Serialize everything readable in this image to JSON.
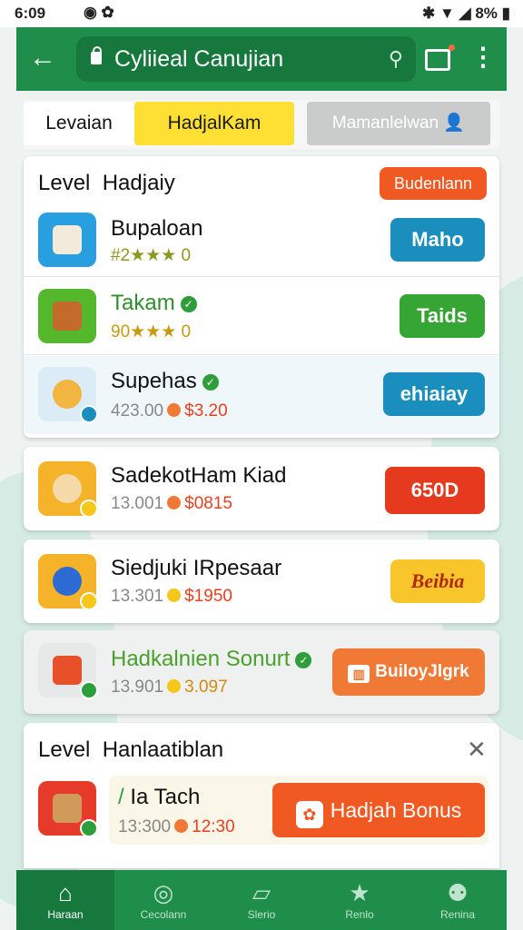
{
  "status_bar": {
    "time": "6:09",
    "battery": "8%"
  },
  "app_bar": {
    "title": "Cyliieal Canujian"
  },
  "tabs": [
    "Levaian",
    "HadjalKam",
    "Mamanlelwan"
  ],
  "section1": {
    "heading": "Level  Hadjaiy",
    "badge": "Budenlann",
    "items": [
      {
        "name": "Bupaloan",
        "sub": "#2★★★ 0",
        "button": "Maho",
        "button_color": "#1a8fbe"
      },
      {
        "name": "Takam",
        "sub": "90★★★ 0",
        "button": "Taids",
        "button_color": "#35a534"
      },
      {
        "name": "Supehas",
        "sub_gray": "423.00",
        "sub_red": "$3.20",
        "button": "ehiaiay",
        "button_color": "#1a8fbe"
      }
    ]
  },
  "cards": [
    {
      "name": "SadekotHam Kiad",
      "sub_gray": "13.001",
      "sub_price": "$0815",
      "button": "650D",
      "button_color": "#e63a1e"
    },
    {
      "name": "Siedjuki IRpesaar",
      "sub_gray": "13.301",
      "sub_price": "$1950",
      "button": "Beibia",
      "button_color": "#f8c52a"
    },
    {
      "name": "Hadkalnien Sonurt",
      "sub_gray": "13.901",
      "sub_price": "3.097",
      "button": "BuiloyJlgrk",
      "button_color": "#f07a35"
    }
  ],
  "section2": {
    "heading": "Level  Hanlaatiblan",
    "item": {
      "name": "Ia Tach",
      "sub_gray": "13:300",
      "sub_price": "12:30",
      "button": "Hadjah Bonus"
    }
  },
  "bottom_nav": [
    "Haraan",
    "Cecolann",
    "Slerio",
    "Renlo",
    "Renina"
  ],
  "colors": {
    "primary": "#1e8e4a",
    "accent_orange": "#f05a22",
    "accent_yellow": "#fde033"
  }
}
